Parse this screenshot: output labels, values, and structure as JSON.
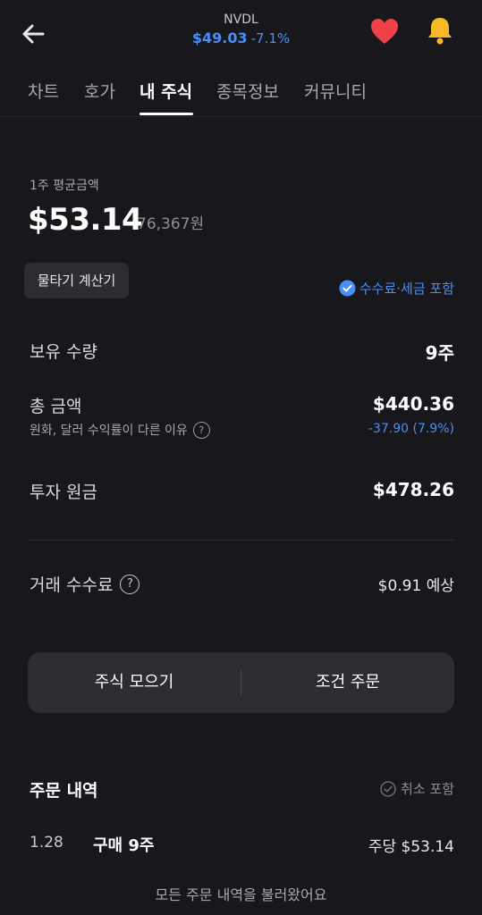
{
  "header": {
    "ticker": "NVDL",
    "price": "$49.03",
    "change": "-7.1%",
    "icons": {
      "back": "arrow-left-icon",
      "favorite": "heart-icon",
      "alert": "bell-icon"
    },
    "colors": {
      "accent": "#4a8ff5",
      "heart": "#f0414a",
      "bell": "#f7b928"
    }
  },
  "tabs": [
    {
      "label": "차트",
      "active": false
    },
    {
      "label": "호가",
      "active": false
    },
    {
      "label": "내 주식",
      "active": true
    },
    {
      "label": "종목정보",
      "active": false
    },
    {
      "label": "커뮤니티",
      "active": false
    }
  ],
  "avg": {
    "label": "1주 평균금액",
    "price": "$53.14",
    "krw": "76,367원"
  },
  "calc_button": "물타기 계산기",
  "fee_note": "수수료·세금 포함",
  "holdings": {
    "qty_label": "보유 수량",
    "qty_value": "9주",
    "total_label": "총 금액",
    "total_value": "$440.36",
    "total_sub_label": "원화, 달러 수익률이 다른 이유",
    "total_sub_value": "-37.90 (7.9%)",
    "principal_label": "투자 원금",
    "principal_value": "$478.26",
    "fee_label": "거래 수수료",
    "fee_value": "$0.91 예상"
  },
  "actions": {
    "left": "주식 모으기",
    "right": "조건 주문"
  },
  "orders": {
    "title": "주문 내역",
    "cancel_include": "취소 포함",
    "items": [
      {
        "date": "1.28",
        "desc": "구매 9주",
        "price": "주당 $53.14"
      }
    ],
    "footer": "모든 주문 내역을 불러왔어요"
  }
}
